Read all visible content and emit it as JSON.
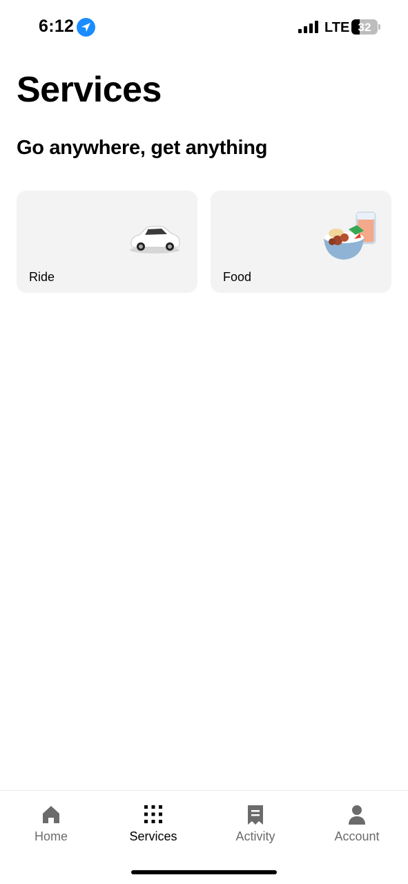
{
  "status_bar": {
    "time": "6:12",
    "network": "LTE",
    "battery_level": "32",
    "icons": [
      "location-icon",
      "signal-icon",
      "battery-icon"
    ],
    "location_color": "#1a8cff"
  },
  "header": {
    "title": "Services",
    "subtitle": "Go anywhere, get anything"
  },
  "services": [
    {
      "label": "Ride",
      "icon": "car-icon"
    },
    {
      "label": "Food",
      "icon": "food-bowl-icon"
    }
  ],
  "bottom_nav": {
    "items": [
      {
        "label": "Home",
        "icon": "home-icon",
        "active": false
      },
      {
        "label": "Services",
        "icon": "grid-icon",
        "active": true
      },
      {
        "label": "Activity",
        "icon": "receipt-icon",
        "active": false
      },
      {
        "label": "Account",
        "icon": "person-icon",
        "active": false
      }
    ]
  },
  "colors": {
    "card_background": "#f3f3f3",
    "inactive_nav": "#6b6b6b",
    "active_nav": "#000000"
  }
}
